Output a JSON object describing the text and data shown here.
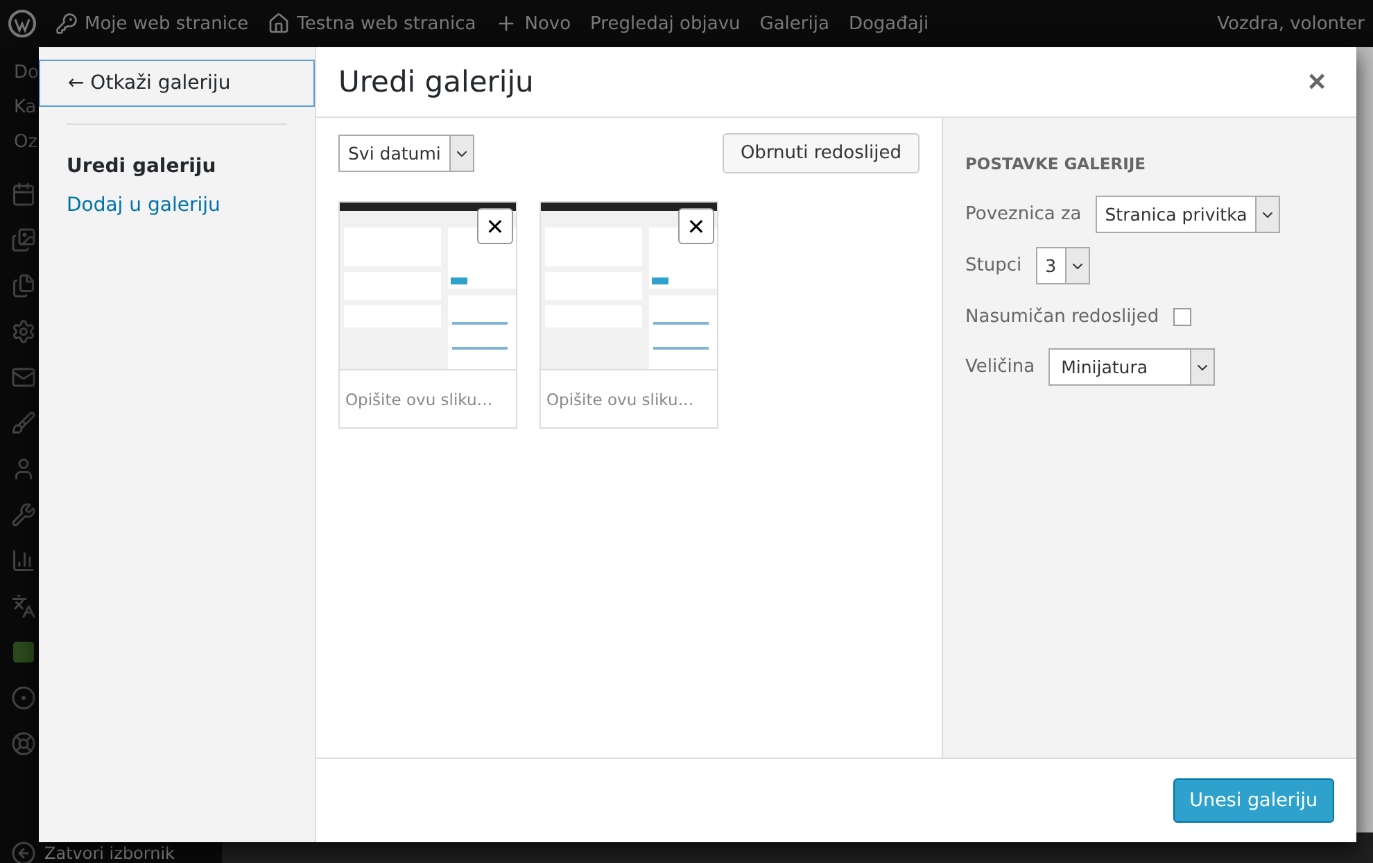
{
  "admin_bar": {
    "items": [
      "Moje web stranice",
      "Testna web stranica",
      "Novo",
      "Pregledaj objavu",
      "Galerija",
      "Događaji"
    ],
    "account": "Vozdra, volonter"
  },
  "admin_menu": {
    "items": [
      "Do",
      "Ka",
      "Oz"
    ],
    "collapse_label": "Zatvori izbornik"
  },
  "modal": {
    "cancel_link": "← Otkaži galeriju",
    "menu": [
      {
        "label": "Uredi galeriju",
        "selected": true
      },
      {
        "label": "Dodaj u galeriju",
        "selected": false
      }
    ],
    "title": "Uredi galeriju",
    "close": "×",
    "date_filter": "Svi datumi",
    "reverse_button": "Obrnuti redoslijed",
    "attachments": [
      {
        "kind": "picture",
        "remove": "✕",
        "caption_placeholder": "Opišite ovu sliku…"
      },
      {
        "kind": "picture",
        "remove": "✕",
        "caption_placeholder": "Opišite ovu sliku…"
      }
    ],
    "settings": {
      "heading": "POSTAVKE GALERIJE",
      "link_label": "Poveznica za",
      "link_value": "Stranica privitka",
      "columns_label": "Stupci",
      "columns_value": "3",
      "random_label": "Nasumičan redoslijed",
      "random_checked": false,
      "size_label": "Veličina",
      "size_value": "Minijatura"
    },
    "insert_button": "Unesi galeriju"
  }
}
